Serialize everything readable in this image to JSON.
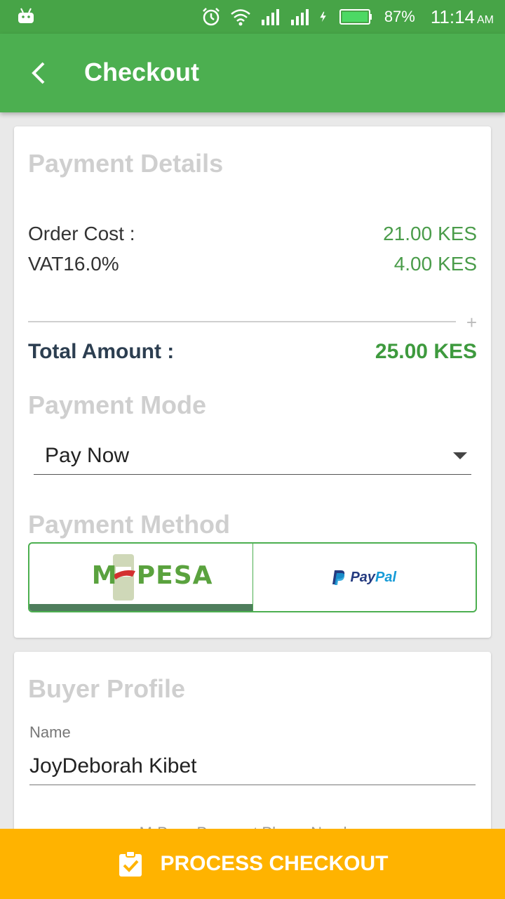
{
  "status_bar": {
    "battery_percent": "87%",
    "time": "11:14",
    "ampm": "AM"
  },
  "app_bar": {
    "title": "Checkout"
  },
  "payment_details": {
    "heading": "Payment Details",
    "rows": [
      {
        "label": "Order Cost :",
        "value": "21.00 KES"
      },
      {
        "label": "VAT16.0%",
        "value": "4.00 KES"
      }
    ],
    "plus_symbol": "+",
    "total_label": "Total Amount :",
    "total_value": "25.00 KES"
  },
  "payment_mode": {
    "heading": "Payment Mode",
    "selected": "Pay Now"
  },
  "payment_method": {
    "heading": "Payment Method",
    "options": [
      {
        "name": "M-PESA",
        "logo_left": "M",
        "logo_right": "PESA",
        "selected": true
      },
      {
        "name": "PayPal",
        "logo_a": "Pay",
        "logo_b": "Pal",
        "selected": false
      }
    ]
  },
  "buyer_profile": {
    "heading": "Buyer Profile",
    "name_label": "Name",
    "name_value": "JoyDeborah Kibet",
    "cutoff_text": "M-Pesa Payment Phone Number"
  },
  "action": {
    "label": "PROCESS CHECKOUT"
  },
  "colors": {
    "primary": "#4caf50",
    "status_bar": "#47a447",
    "accent": "#ffb300",
    "value_green": "#4a9c4a"
  }
}
